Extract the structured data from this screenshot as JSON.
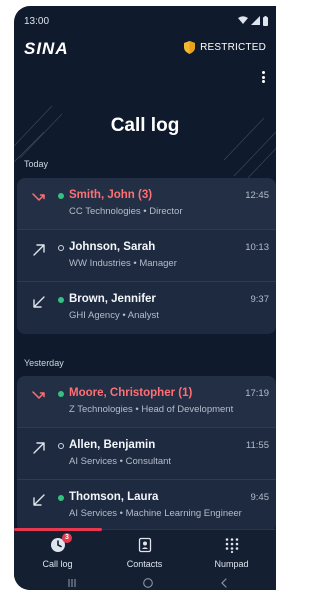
{
  "status_bar": {
    "time": "13:00"
  },
  "brand": {
    "logo": "SINA",
    "badge_label": "RESTRICTED",
    "accent": "#f5b82e"
  },
  "page": {
    "title": "Call log"
  },
  "sections": [
    {
      "title": "Today",
      "calls": [
        {
          "name": "Smith, John (3)",
          "meta": "CC Technologies • Director",
          "time": "12:45",
          "direction": "missed",
          "presence": "online"
        },
        {
          "name": "Johnson, Sarah",
          "meta": "WW Industries • Manager",
          "time": "10:13",
          "direction": "outgoing",
          "presence": "offline"
        },
        {
          "name": "Brown, Jennifer",
          "meta": "GHI Agency • Analyst",
          "time": "9:37",
          "direction": "incoming",
          "presence": "online"
        }
      ]
    },
    {
      "title": "Yesterday",
      "calls": [
        {
          "name": "Moore, Christopher (1)",
          "meta": "Z Technologies • Head of Development",
          "time": "17:19",
          "direction": "missed",
          "presence": "online"
        },
        {
          "name": "Allen, Benjamin",
          "meta": "AI Services • Consultant",
          "time": "11:55",
          "direction": "outgoing",
          "presence": "offline"
        },
        {
          "name": "Thomson, Laura",
          "meta": "AI Services • Machine Learning Engineer",
          "time": "9:45",
          "direction": "incoming",
          "presence": "online"
        }
      ]
    }
  ],
  "bottom_nav": {
    "tabs": [
      {
        "label": "Call log",
        "icon": "call-log-icon",
        "badge": "3",
        "active": true
      },
      {
        "label": "Contacts",
        "icon": "contacts-icon"
      },
      {
        "label": "Numpad",
        "icon": "numpad-icon"
      }
    ]
  },
  "colors": {
    "background": "#0f1a2c",
    "card": "#1e2a40",
    "missed": "#ff6f73",
    "online": "#36c183",
    "active_tab": "#e8384f"
  }
}
